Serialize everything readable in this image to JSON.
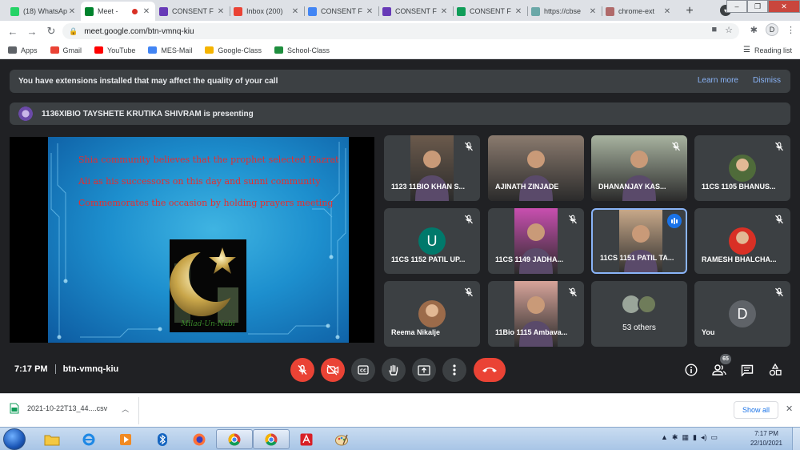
{
  "browser": {
    "tabs": [
      {
        "title": "(18) WhatsApp",
        "favicon": "whatsapp-icon",
        "color": "#25d366"
      },
      {
        "title": "Meet -",
        "favicon": "meet-icon",
        "color": "#00832d",
        "active": true,
        "recording": true
      },
      {
        "title": "CONSENT F",
        "favicon": "forms-icon",
        "color": "#673ab7"
      },
      {
        "title": "Inbox (200)",
        "favicon": "gmail-icon",
        "color": "#ea4335"
      },
      {
        "title": "CONSENT F",
        "favicon": "docs-icon",
        "color": "#4285f4"
      },
      {
        "title": "CONSENT F",
        "favicon": "forms-icon",
        "color": "#673ab7"
      },
      {
        "title": "CONSENT F",
        "favicon": "sheets-icon",
        "color": "#0f9d58"
      },
      {
        "title": "https://cbse",
        "favicon": "globe-icon",
        "color": "#6aa8a8"
      },
      {
        "title": "chrome-ext",
        "favicon": "extension-icon",
        "color": "#b06a6a"
      }
    ],
    "url": "meet.google.com/btn-vmnq-kiu",
    "profile_initial": "D",
    "bookmarks": [
      {
        "label": "Apps",
        "icon": "apps-grid-icon",
        "color": "#5f6368"
      },
      {
        "label": "Gmail",
        "icon": "gmail-icon",
        "color": "#ea4335"
      },
      {
        "label": "YouTube",
        "icon": "youtube-icon",
        "color": "#ff0000"
      },
      {
        "label": "MES-Mail",
        "icon": "google-icon",
        "color": "#4285f4"
      },
      {
        "label": "Google-Class",
        "icon": "classroom-icon",
        "color": "#f5b400"
      },
      {
        "label": "School-Class",
        "icon": "classroom-icon",
        "color": "#1e8e3e"
      }
    ],
    "reading_list": "Reading list"
  },
  "meet": {
    "notice": {
      "text": "You have extensions installed that may affect the quality of your call",
      "learn_more": "Learn more",
      "dismiss": "Dismiss"
    },
    "presenting_text": "1136XIBIO TAYSHETE KRUTIKA SHIVRAM is presenting",
    "slide": {
      "lines": [
        "Shia community believes that the prophet selected Hazrat",
        "Ali as his successors on this day and sunni community",
        "Commemorates the occasion by holding prayers meeting"
      ],
      "image_caption": "Milad-Un-Nabi"
    },
    "participants": [
      {
        "name": "1123 11BIO KHAN S...",
        "kind": "video",
        "bg": "#6b5a4c",
        "muted": true
      },
      {
        "name": "AJINATH ZINJADE",
        "kind": "video",
        "bg": "#8a7a6e",
        "muted": false
      },
      {
        "name": "DHANANJAY KAS...",
        "kind": "video",
        "bg": "#a8b3a0",
        "muted": true
      },
      {
        "name": "11CS 1105 BHANUS...",
        "kind": "photo",
        "bg": "#4f6b3a",
        "muted": true
      },
      {
        "name": "11CS 1152 PATIL UP...",
        "kind": "letter",
        "letter": "U",
        "bg": "#00796b",
        "muted": true
      },
      {
        "name": "11CS 1149 JADHA...",
        "kind": "video",
        "bg": "#c94fb0",
        "muted": true
      },
      {
        "name": "11CS 1151 PATIL TA...",
        "kind": "video",
        "bg": "#c7a889",
        "muted": false,
        "speaking": true
      },
      {
        "name": "RAMESH BHALCHA...",
        "kind": "photo",
        "bg": "#d93025",
        "muted": true
      },
      {
        "name": "Reema Nikalje",
        "kind": "photo",
        "bg": "#9c6b4a",
        "muted": true
      },
      {
        "name": "11Bio 1115 Ambava...",
        "kind": "video",
        "bg": "#d7a49a",
        "muted": true
      },
      {
        "name": "53 others",
        "kind": "others"
      },
      {
        "name": "You",
        "kind": "letter",
        "letter": "D",
        "bg": "#5f6368",
        "muted": true
      }
    ],
    "time": "7:17 PM",
    "meeting_code": "btn-vmnq-kiu",
    "participant_count": "65"
  },
  "downloads": {
    "file": "2021-10-22T13_44....csv",
    "show_all": "Show all"
  },
  "taskbar": {
    "time": "7:17 PM",
    "date": "22/10/2021"
  }
}
